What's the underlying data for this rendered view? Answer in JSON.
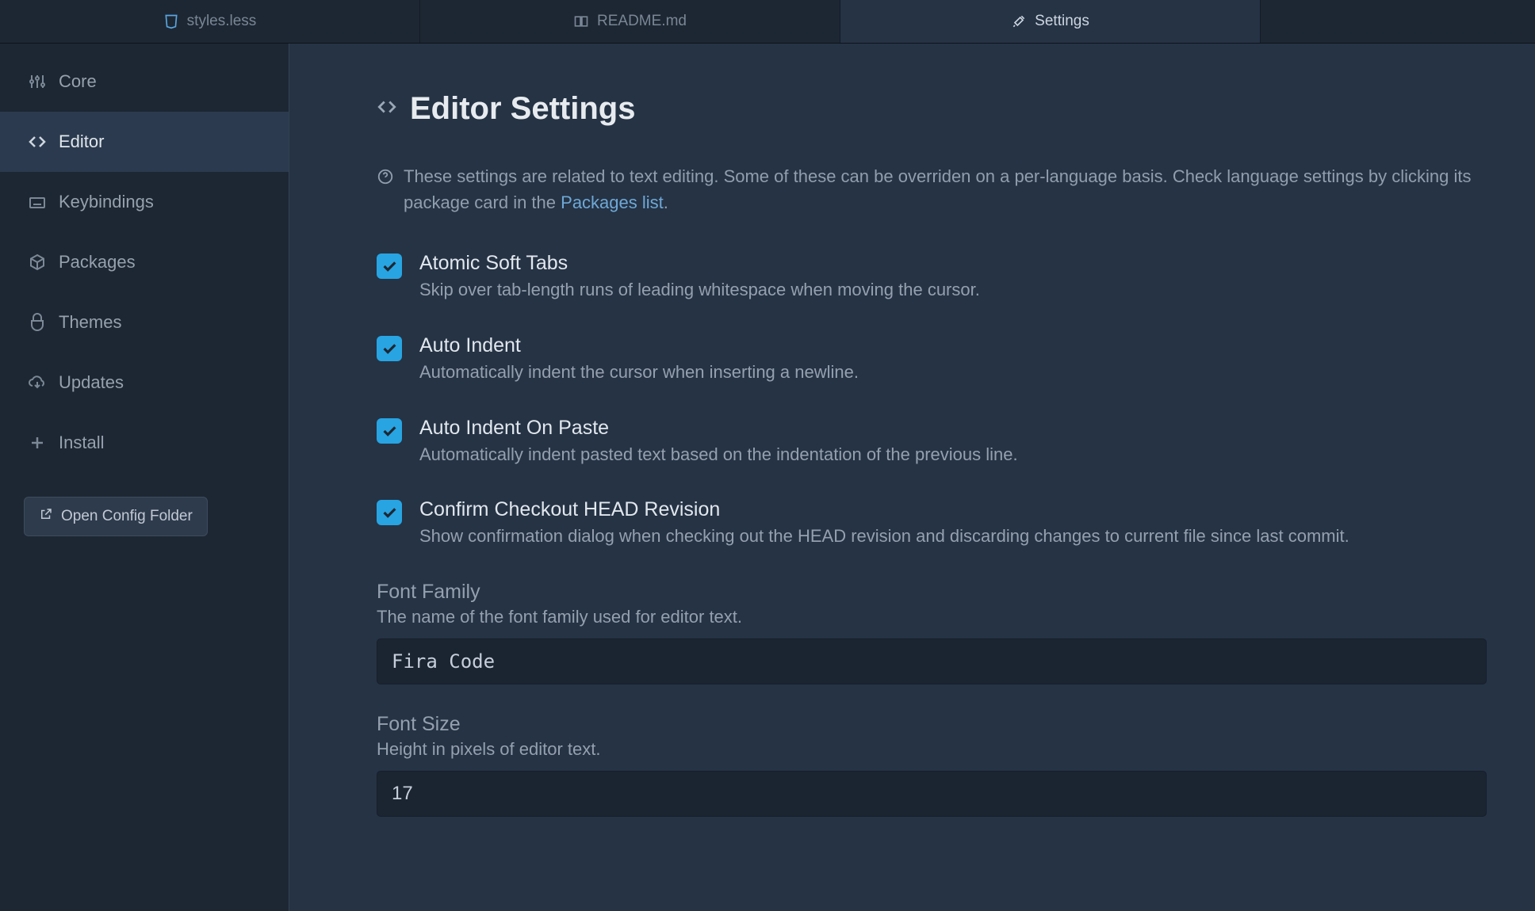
{
  "tabs": [
    {
      "label": "styles.less",
      "icon": "css"
    },
    {
      "label": "README.md",
      "icon": "book"
    },
    {
      "label": "Settings",
      "icon": "tools"
    }
  ],
  "sidebar": {
    "items": [
      {
        "label": "Core"
      },
      {
        "label": "Editor"
      },
      {
        "label": "Keybindings"
      },
      {
        "label": "Packages"
      },
      {
        "label": "Themes"
      },
      {
        "label": "Updates"
      },
      {
        "label": "Install"
      }
    ],
    "open_config_label": "Open Config Folder"
  },
  "main": {
    "title": "Editor Settings",
    "note_prefix": "These settings are related to text editing. Some of these can be overriden on a per-language basis. Check language settings by clicking its package card in the ",
    "note_link": "Packages list",
    "note_suffix": ".",
    "settings": [
      {
        "label": "Atomic Soft Tabs",
        "desc": "Skip over tab-length runs of leading whitespace when moving the cursor.",
        "checked": true
      },
      {
        "label": "Auto Indent",
        "desc": "Automatically indent the cursor when inserting a newline.",
        "checked": true
      },
      {
        "label": "Auto Indent On Paste",
        "desc": "Automatically indent pasted text based on the indentation of the previous line.",
        "checked": true
      },
      {
        "label": "Confirm Checkout HEAD Revision",
        "desc": "Show confirmation dialog when checking out the HEAD revision and discarding changes to current file since last commit.",
        "checked": true
      }
    ],
    "font_family": {
      "label": "Font Family",
      "desc": "The name of the font family used for editor text.",
      "value": "Fira Code"
    },
    "font_size": {
      "label": "Font Size",
      "desc": "Height in pixels of editor text.",
      "value": "17"
    }
  }
}
